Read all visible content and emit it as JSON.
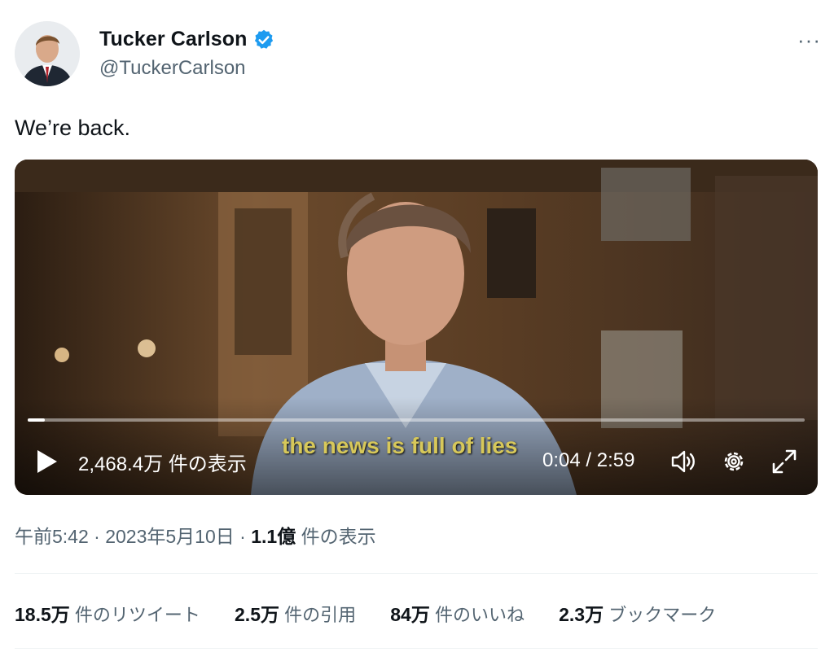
{
  "author": {
    "display_name": "Tucker Carlson",
    "handle": "@TuckerCarlson"
  },
  "more_label": "···",
  "tweet_text": "We’re back.",
  "video": {
    "progress": 0.022,
    "views_label": "2,468.4万 件の表示",
    "subtitle": "the news is full of lies",
    "time": "0:04 / 2:59"
  },
  "meta": {
    "time": "午前5:42",
    "sep1": " · ",
    "date": "2023年5月10日",
    "sep2": " · ",
    "views_count": "1.1億",
    "views_label": " 件の表示"
  },
  "stats": [
    {
      "count": "18.5万",
      "label": " 件のリツイート"
    },
    {
      "count": "2.5万",
      "label": " 件の引用"
    },
    {
      "count": "84万",
      "label": " 件のいいね"
    },
    {
      "count": "2.3万",
      "label": " ブックマーク"
    }
  ],
  "colors": {
    "verified": "#1d9bf0",
    "subtitle": "#d7c85a",
    "secondary_text": "#536471"
  }
}
